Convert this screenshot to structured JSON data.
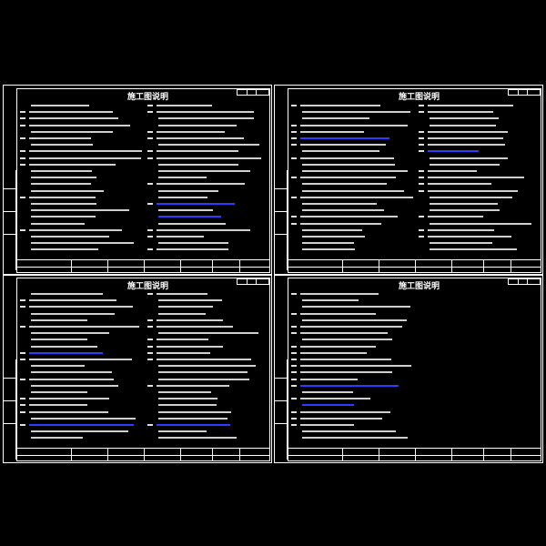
{
  "title_label": "施工图说明",
  "sheets": [
    {
      "id": "sheet-1",
      "title": "施工图说明"
    },
    {
      "id": "sheet-2",
      "title": "施工图说明"
    },
    {
      "id": "sheet-3",
      "title": "施工图说明"
    },
    {
      "id": "sheet-4",
      "title": "施工图说明"
    }
  ],
  "colors": {
    "background": "#000000",
    "lines": "#ffffff",
    "text": "#cfcfcf",
    "heading": "#2f3cff"
  }
}
